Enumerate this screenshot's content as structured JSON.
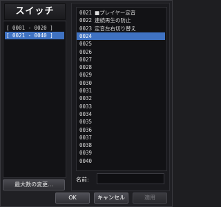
{
  "window": {
    "title": "スイッチ"
  },
  "ranges": [
    {
      "label": "[ 0001 - 0020 ]",
      "selected": false
    },
    {
      "label": "[ 0021 - 0040 ]",
      "selected": true
    }
  ],
  "switches": [
    {
      "num": "0021",
      "name": "■プレイヤー定音"
    },
    {
      "num": "0022",
      "name": "連続再生の防止"
    },
    {
      "num": "0023",
      "name": "定音左右切り替え"
    },
    {
      "num": "0024",
      "name": "",
      "selected": true
    },
    {
      "num": "0025",
      "name": ""
    },
    {
      "num": "0026",
      "name": ""
    },
    {
      "num": "0027",
      "name": ""
    },
    {
      "num": "0028",
      "name": ""
    },
    {
      "num": "0029",
      "name": ""
    },
    {
      "num": "0030",
      "name": ""
    },
    {
      "num": "0031",
      "name": ""
    },
    {
      "num": "0032",
      "name": ""
    },
    {
      "num": "0033",
      "name": ""
    },
    {
      "num": "0034",
      "name": ""
    },
    {
      "num": "0035",
      "name": ""
    },
    {
      "num": "0036",
      "name": ""
    },
    {
      "num": "0037",
      "name": ""
    },
    {
      "num": "0038",
      "name": ""
    },
    {
      "num": "0039",
      "name": ""
    },
    {
      "num": "0040",
      "name": ""
    }
  ],
  "buttons": {
    "max_change": "最大数の変更...",
    "ok": "OK",
    "cancel": "キャンセル",
    "apply": "適用"
  },
  "name_field": {
    "label": "名前:",
    "value": ""
  }
}
